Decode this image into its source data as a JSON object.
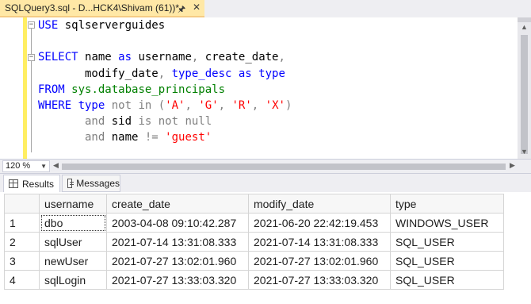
{
  "tab": {
    "title": "SQLQuery3.sql - D...HCK4\\Shivam (61))*",
    "pin_icon": "pin-icon",
    "close_icon": "close-icon"
  },
  "editor": {
    "lines": [
      [
        {
          "t": "USE ",
          "c": "kw"
        },
        {
          "t": "sqlserverguides",
          "c": ""
        }
      ],
      [],
      [
        {
          "t": "SELECT ",
          "c": "kw"
        },
        {
          "t": "name ",
          "c": ""
        },
        {
          "t": "as ",
          "c": "kw"
        },
        {
          "t": "username",
          "c": ""
        },
        {
          "t": ", ",
          "c": "gr"
        },
        {
          "t": "create_date",
          "c": ""
        },
        {
          "t": ",",
          "c": "gr"
        }
      ],
      [
        {
          "t": "       modify_date",
          "c": ""
        },
        {
          "t": ", ",
          "c": "gr"
        },
        {
          "t": "type_desc ",
          "c": "kw"
        },
        {
          "t": "as ",
          "c": "kw"
        },
        {
          "t": "type",
          "c": "kw"
        }
      ],
      [
        {
          "t": "FROM ",
          "c": "kw"
        },
        {
          "t": "sys.database_principals",
          "c": "sys"
        }
      ],
      [
        {
          "t": "WHERE ",
          "c": "kw"
        },
        {
          "t": "type ",
          "c": "kw"
        },
        {
          "t": "not in ",
          "c": "gr"
        },
        {
          "t": "(",
          "c": "gr"
        },
        {
          "t": "'A'",
          "c": "st"
        },
        {
          "t": ", ",
          "c": "gr"
        },
        {
          "t": "'G'",
          "c": "st"
        },
        {
          "t": ", ",
          "c": "gr"
        },
        {
          "t": "'R'",
          "c": "st"
        },
        {
          "t": ", ",
          "c": "gr"
        },
        {
          "t": "'X'",
          "c": "st"
        },
        {
          "t": ")",
          "c": "gr"
        }
      ],
      [
        {
          "t": "       and ",
          "c": "gr"
        },
        {
          "t": "sid ",
          "c": ""
        },
        {
          "t": "is not null",
          "c": "gr"
        }
      ],
      [
        {
          "t": "       and ",
          "c": "gr"
        },
        {
          "t": "name ",
          "c": ""
        },
        {
          "t": "!= ",
          "c": "gr"
        },
        {
          "t": "'guest'",
          "c": "st"
        }
      ]
    ]
  },
  "zoom": {
    "value": "120 %"
  },
  "results_tabs": [
    {
      "label": "Results",
      "icon": "grid-icon"
    },
    {
      "label": "Messages",
      "icon": "messages-icon"
    }
  ],
  "results": {
    "columns": [
      "",
      "username",
      "create_date",
      "modify_date",
      "type"
    ],
    "rows": [
      [
        "1",
        "dbo",
        "2003-04-08 09:10:42.287",
        "2021-06-20 22:42:19.453",
        "WINDOWS_USER"
      ],
      [
        "2",
        "sqlUser",
        "2021-07-14 13:31:08.333",
        "2021-07-14 13:31:08.333",
        "SQL_USER"
      ],
      [
        "3",
        "newUser",
        "2021-07-27 13:02:01.960",
        "2021-07-27 13:02:01.960",
        "SQL_USER"
      ],
      [
        "4",
        "sqlLogin",
        "2021-07-27 13:33:03.320",
        "2021-07-27 13:33:03.320",
        "SQL_USER"
      ]
    ]
  }
}
